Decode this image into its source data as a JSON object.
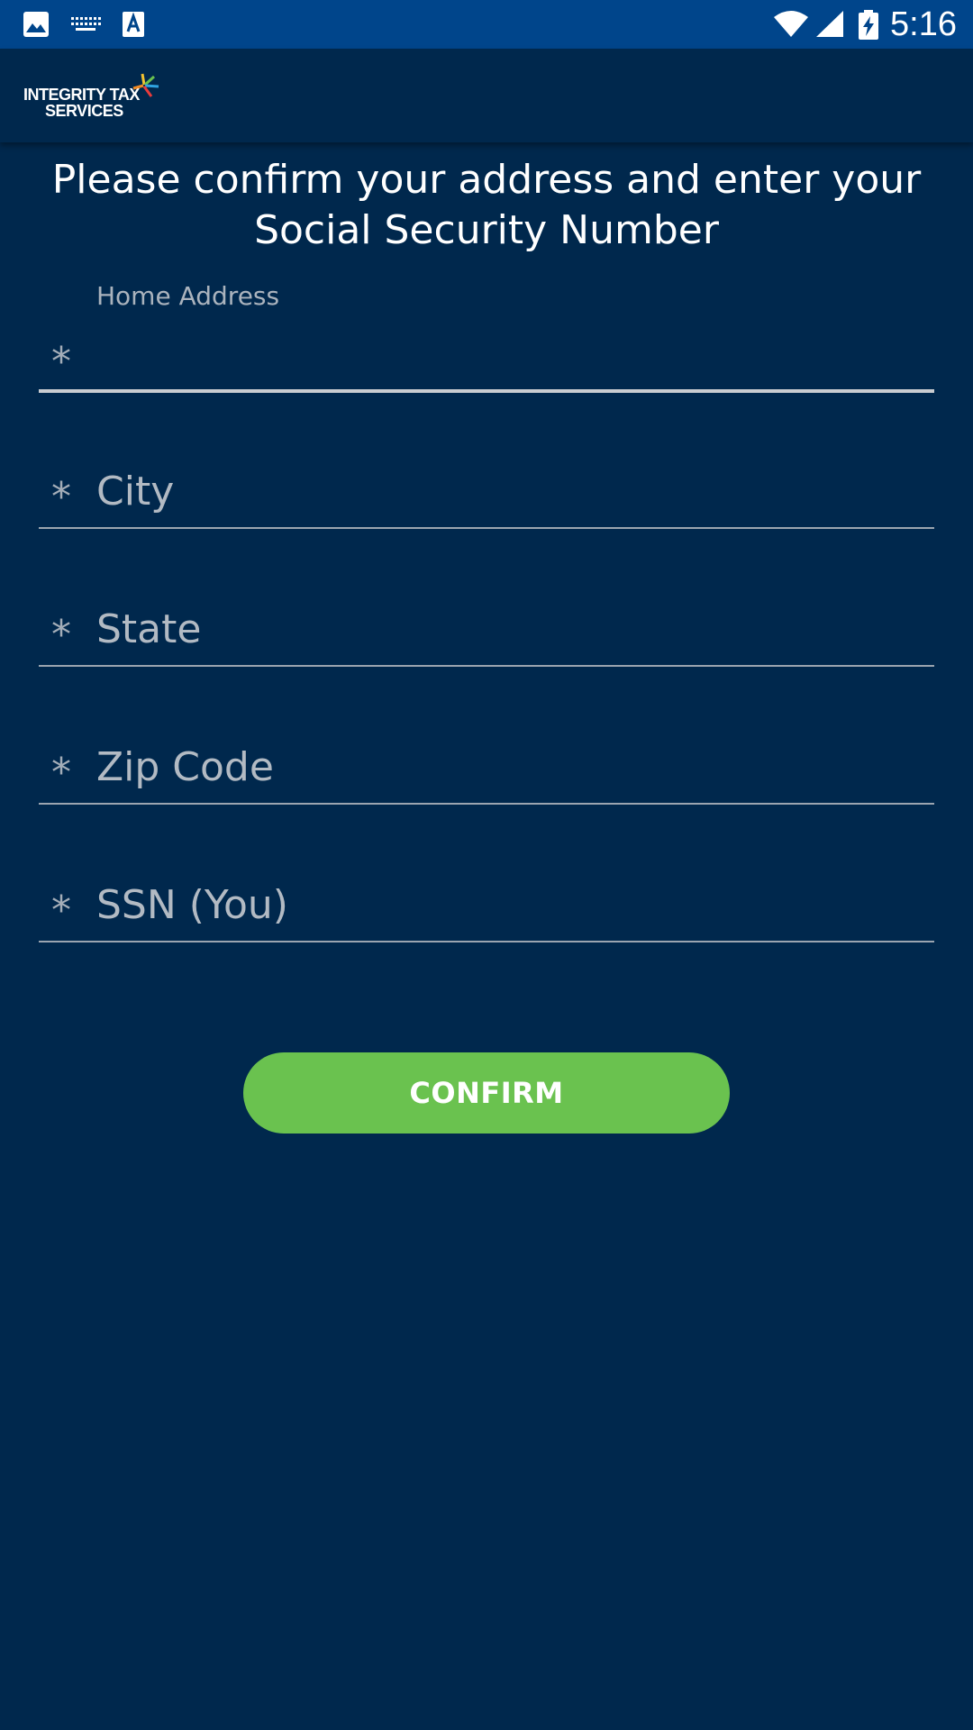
{
  "status_bar": {
    "time": "5:16",
    "icons": [
      "image-icon",
      "keyboard-icon",
      "text-a-icon",
      "wifi-icon",
      "signal-icon",
      "battery-charging-icon"
    ]
  },
  "app_bar": {
    "logo_line1": "INTEGRITY TAX",
    "logo_line2": "SERVICES"
  },
  "heading": "Please confirm your address and enter your Social Security Number",
  "form": {
    "required_marker": "*",
    "home_address": {
      "label": "Home Address",
      "value": ""
    },
    "city": {
      "placeholder": "City"
    },
    "state": {
      "placeholder": "State"
    },
    "zip_code": {
      "placeholder": "Zip Code"
    },
    "ssn": {
      "placeholder": "SSN (You)"
    }
  },
  "confirm_button": {
    "label": "CONFIRM"
  },
  "colors": {
    "status_bar": "#00458b",
    "background": "#00284d",
    "button": "#6ac24f",
    "placeholder": "#b2bac3"
  }
}
